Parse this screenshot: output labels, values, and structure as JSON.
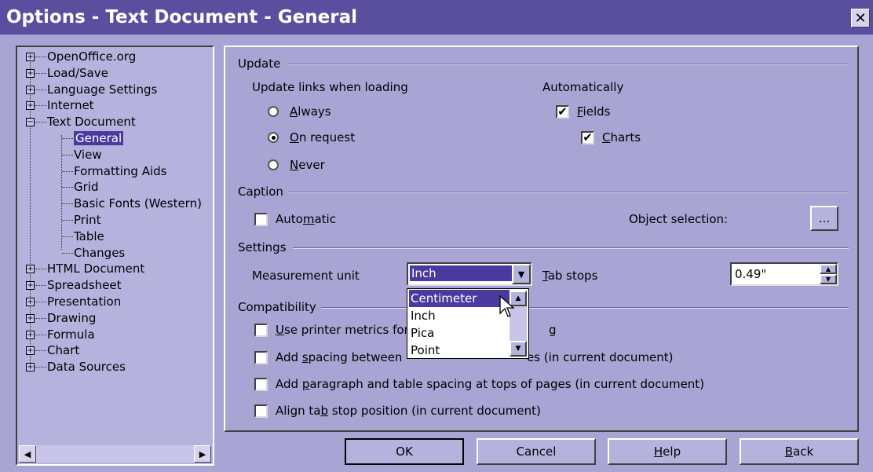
{
  "window": {
    "title": "Options - Text Document - General",
    "close_glyph": "✕"
  },
  "tree": {
    "items": [
      {
        "label": "OpenOffice.org",
        "expander": "+"
      },
      {
        "label": "Load/Save",
        "expander": "+"
      },
      {
        "label": "Language Settings",
        "expander": "+"
      },
      {
        "label": "Internet",
        "expander": "+"
      },
      {
        "label": "Text Document",
        "expander": "−"
      },
      {
        "label": "General"
      },
      {
        "label": "View"
      },
      {
        "label": "Formatting Aids"
      },
      {
        "label": "Grid"
      },
      {
        "label": "Basic Fonts (Western)"
      },
      {
        "label": "Print"
      },
      {
        "label": "Table"
      },
      {
        "label": "Changes"
      },
      {
        "label": "HTML Document",
        "expander": "+"
      },
      {
        "label": "Spreadsheet",
        "expander": "+"
      },
      {
        "label": "Presentation",
        "expander": "+"
      },
      {
        "label": "Drawing",
        "expander": "+"
      },
      {
        "label": "Formula",
        "expander": "+"
      },
      {
        "label": "Chart",
        "expander": "+"
      },
      {
        "label": "Data Sources",
        "expander": "+"
      }
    ],
    "scroll_left": "◀",
    "scroll_right": "▶"
  },
  "update": {
    "title": "Update",
    "links_label": "Update links when loading",
    "always": "Always",
    "on_request": "On request",
    "never": "Never",
    "automatically_label": "Automatically",
    "fields": "Fields",
    "charts": "Charts",
    "selected_radio": "on_request"
  },
  "caption": {
    "title": "Caption",
    "automatic": "Automatic",
    "object_selection_label": "Object selection:",
    "object_selection_button": "..."
  },
  "settings": {
    "title": "Settings",
    "measurement_label": "Measurement unit",
    "measurement_value": "Inch",
    "measurement_options": [
      "Centimeter",
      "Inch",
      "Pica",
      "Point"
    ],
    "tab_stops_label": "Tab stops",
    "tab_stops_value": "0.49\""
  },
  "compatibility": {
    "title": "Compatibility",
    "printer_metrics": "Use printer metrics for",
    "printer_metrics_tail": "g",
    "spacing_between": "Add spacing between",
    "spacing_between_tail": "es (in current document)",
    "paragraph_table_spacing": "Add paragraph and table spacing at tops of pages (in current document)",
    "align_tab_stop": "Align tab stop position (in current document)"
  },
  "buttons": {
    "ok": "OK",
    "cancel": "Cancel",
    "help": "Help",
    "back": "Back"
  },
  "check_glyph": "✔"
}
